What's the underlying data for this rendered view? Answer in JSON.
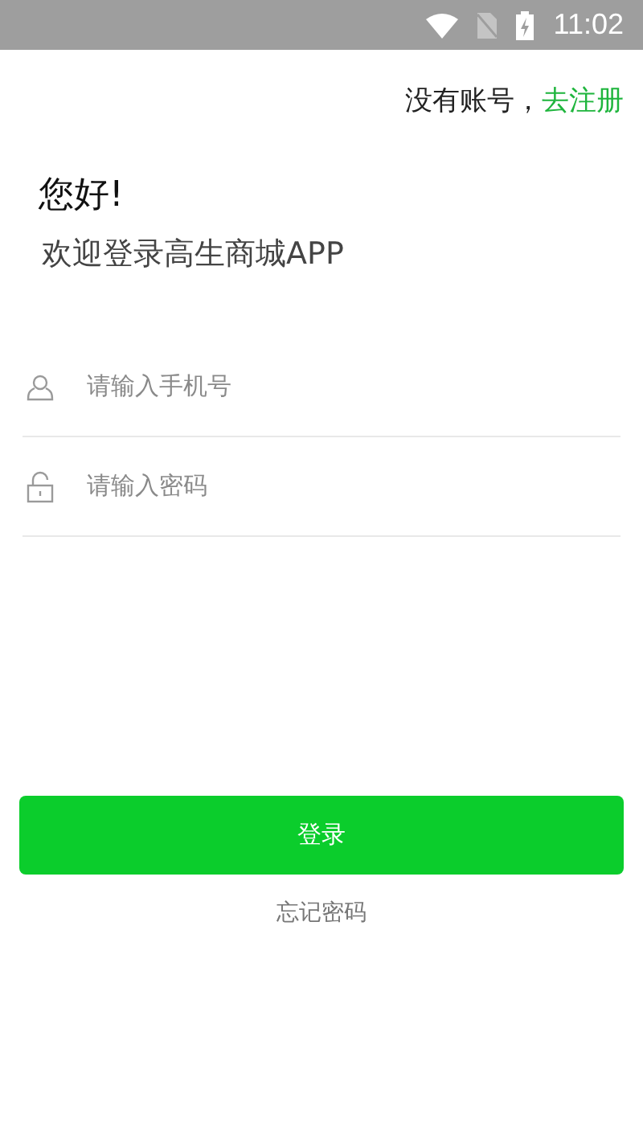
{
  "status_bar": {
    "time": "11:02"
  },
  "register_prompt": {
    "text": "没有账号，",
    "link": "去注册"
  },
  "greeting": {
    "title": "您好!",
    "subtitle": "欢迎登录高生商城APP"
  },
  "fields": [
    {
      "kind": "phone",
      "placeholder": "请输入手机号"
    },
    {
      "kind": "password",
      "placeholder": "请输入密码"
    }
  ],
  "login_button": "登录",
  "forgot_password": "忘记密码"
}
